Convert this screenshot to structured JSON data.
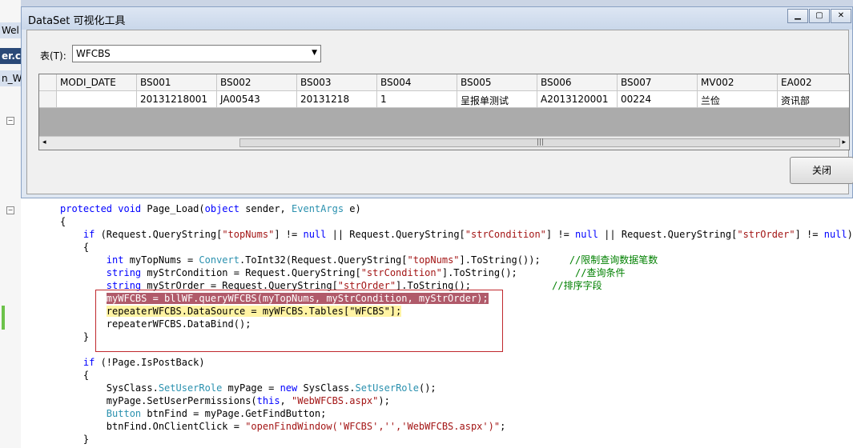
{
  "ide": {
    "tabs": [
      "Wel",
      "er.cs",
      "n_We"
    ],
    "code_lines": [
      [
        {
          "t": "protected void ",
          "c": "kw"
        },
        {
          "t": "Page_Load("
        },
        {
          "t": "object",
          "c": "kw"
        },
        {
          "t": " sender, "
        },
        {
          "t": "EventArgs",
          "c": "ty"
        },
        {
          "t": " e)"
        }
      ],
      [
        {
          "t": "{"
        }
      ],
      [
        {
          "t": "    "
        },
        {
          "t": "if",
          "c": "kw"
        },
        {
          "t": " (Request.QueryString["
        },
        {
          "t": "\"topNums\"",
          "c": "str"
        },
        {
          "t": "] != "
        },
        {
          "t": "null",
          "c": "kw"
        },
        {
          "t": " || Request.QueryString["
        },
        {
          "t": "\"strCondition\"",
          "c": "str"
        },
        {
          "t": "] != "
        },
        {
          "t": "null",
          "c": "kw"
        },
        {
          "t": " || Request.QueryString["
        },
        {
          "t": "\"strOrder\"",
          "c": "str"
        },
        {
          "t": "] != "
        },
        {
          "t": "null",
          "c": "kw"
        },
        {
          "t": ")"
        }
      ],
      [
        {
          "t": "    {"
        }
      ],
      [
        {
          "t": "        "
        },
        {
          "t": "int",
          "c": "kw"
        },
        {
          "t": " myTopNums = "
        },
        {
          "t": "Convert",
          "c": "ty"
        },
        {
          "t": ".ToInt32(Request.QueryString["
        },
        {
          "t": "\"topNums\"",
          "c": "str"
        },
        {
          "t": "].ToString());     "
        },
        {
          "t": "//限制查询数据笔数",
          "c": "cm"
        }
      ],
      [
        {
          "t": "        "
        },
        {
          "t": "string",
          "c": "kw"
        },
        {
          "t": " myStrCondition = Request.QueryString["
        },
        {
          "t": "\"strCondition\"",
          "c": "str"
        },
        {
          "t": "].ToString();          "
        },
        {
          "t": "//查询条件",
          "c": "cm"
        }
      ],
      [
        {
          "t": "        "
        },
        {
          "t": "string",
          "c": "kw"
        },
        {
          "t": " myStrOrder = Request.QueryString["
        },
        {
          "t": "\"strOrder\"",
          "c": "str"
        },
        {
          "t": "].ToString();              "
        },
        {
          "t": "//排序字段",
          "c": "cm"
        }
      ],
      [
        {
          "t": "        "
        },
        {
          "t": "myWFCBS = bllWF.queryWFCBS(myTopNums, myStrCondition, myStrOrder);",
          "c": "hl-red"
        }
      ],
      [
        {
          "t": "        "
        },
        {
          "t": "repeaterWFCBS.DataSource = myWFCBS.Tables[\"WFCBS\"];",
          "c": "hl-yel"
        }
      ],
      [
        {
          "t": "        repeaterWFCBS.DataBind();"
        }
      ],
      [
        {
          "t": "    }"
        }
      ],
      [
        {
          "t": ""
        }
      ],
      [
        {
          "t": "    "
        },
        {
          "t": "if",
          "c": "kw"
        },
        {
          "t": " (!Page.IsPostBack)"
        }
      ],
      [
        {
          "t": "    {"
        }
      ],
      [
        {
          "t": "        SysClass."
        },
        {
          "t": "SetUserRole",
          "c": "ty"
        },
        {
          "t": " myPage = "
        },
        {
          "t": "new",
          "c": "kw"
        },
        {
          "t": " SysClass."
        },
        {
          "t": "SetUserRole",
          "c": "ty"
        },
        {
          "t": "();"
        }
      ],
      [
        {
          "t": "        myPage.SetUserPermissions("
        },
        {
          "t": "this",
          "c": "kw"
        },
        {
          "t": ", "
        },
        {
          "t": "\"WebWFCBS.aspx\"",
          "c": "str"
        },
        {
          "t": ");"
        }
      ],
      [
        {
          "t": "        "
        },
        {
          "t": "Button",
          "c": "ty"
        },
        {
          "t": " btnFind = myPage.GetFindButton;"
        }
      ],
      [
        {
          "t": "        btnFind.OnClientClick = "
        },
        {
          "t": "\"openFindWindow('WFCBS','','WebWFCBS.aspx')\"",
          "c": "str"
        },
        {
          "t": ";"
        }
      ],
      [
        {
          "t": "    }"
        }
      ]
    ]
  },
  "dialog": {
    "title": "DataSet 可视化工具",
    "table_label": "表(T):",
    "table_value": "WFCBS",
    "close_label": "关闭",
    "grid": {
      "columns": [
        "MODI_DATE",
        "BS001",
        "BS002",
        "BS003",
        "BS004",
        "BS005",
        "BS006",
        "BS007",
        "MV002",
        "EA002"
      ],
      "rows": [
        [
          "",
          "20131218001",
          "JA00543",
          "20131218",
          "1",
          "呈报单测试",
          "A2013120001",
          "00224",
          "兰俭",
          "资讯部"
        ]
      ]
    }
  },
  "icons": {
    "minimize": "minimize-icon",
    "maximize": "maximize-icon",
    "close": "close-icon",
    "dropdown": "chevron-down-icon"
  }
}
